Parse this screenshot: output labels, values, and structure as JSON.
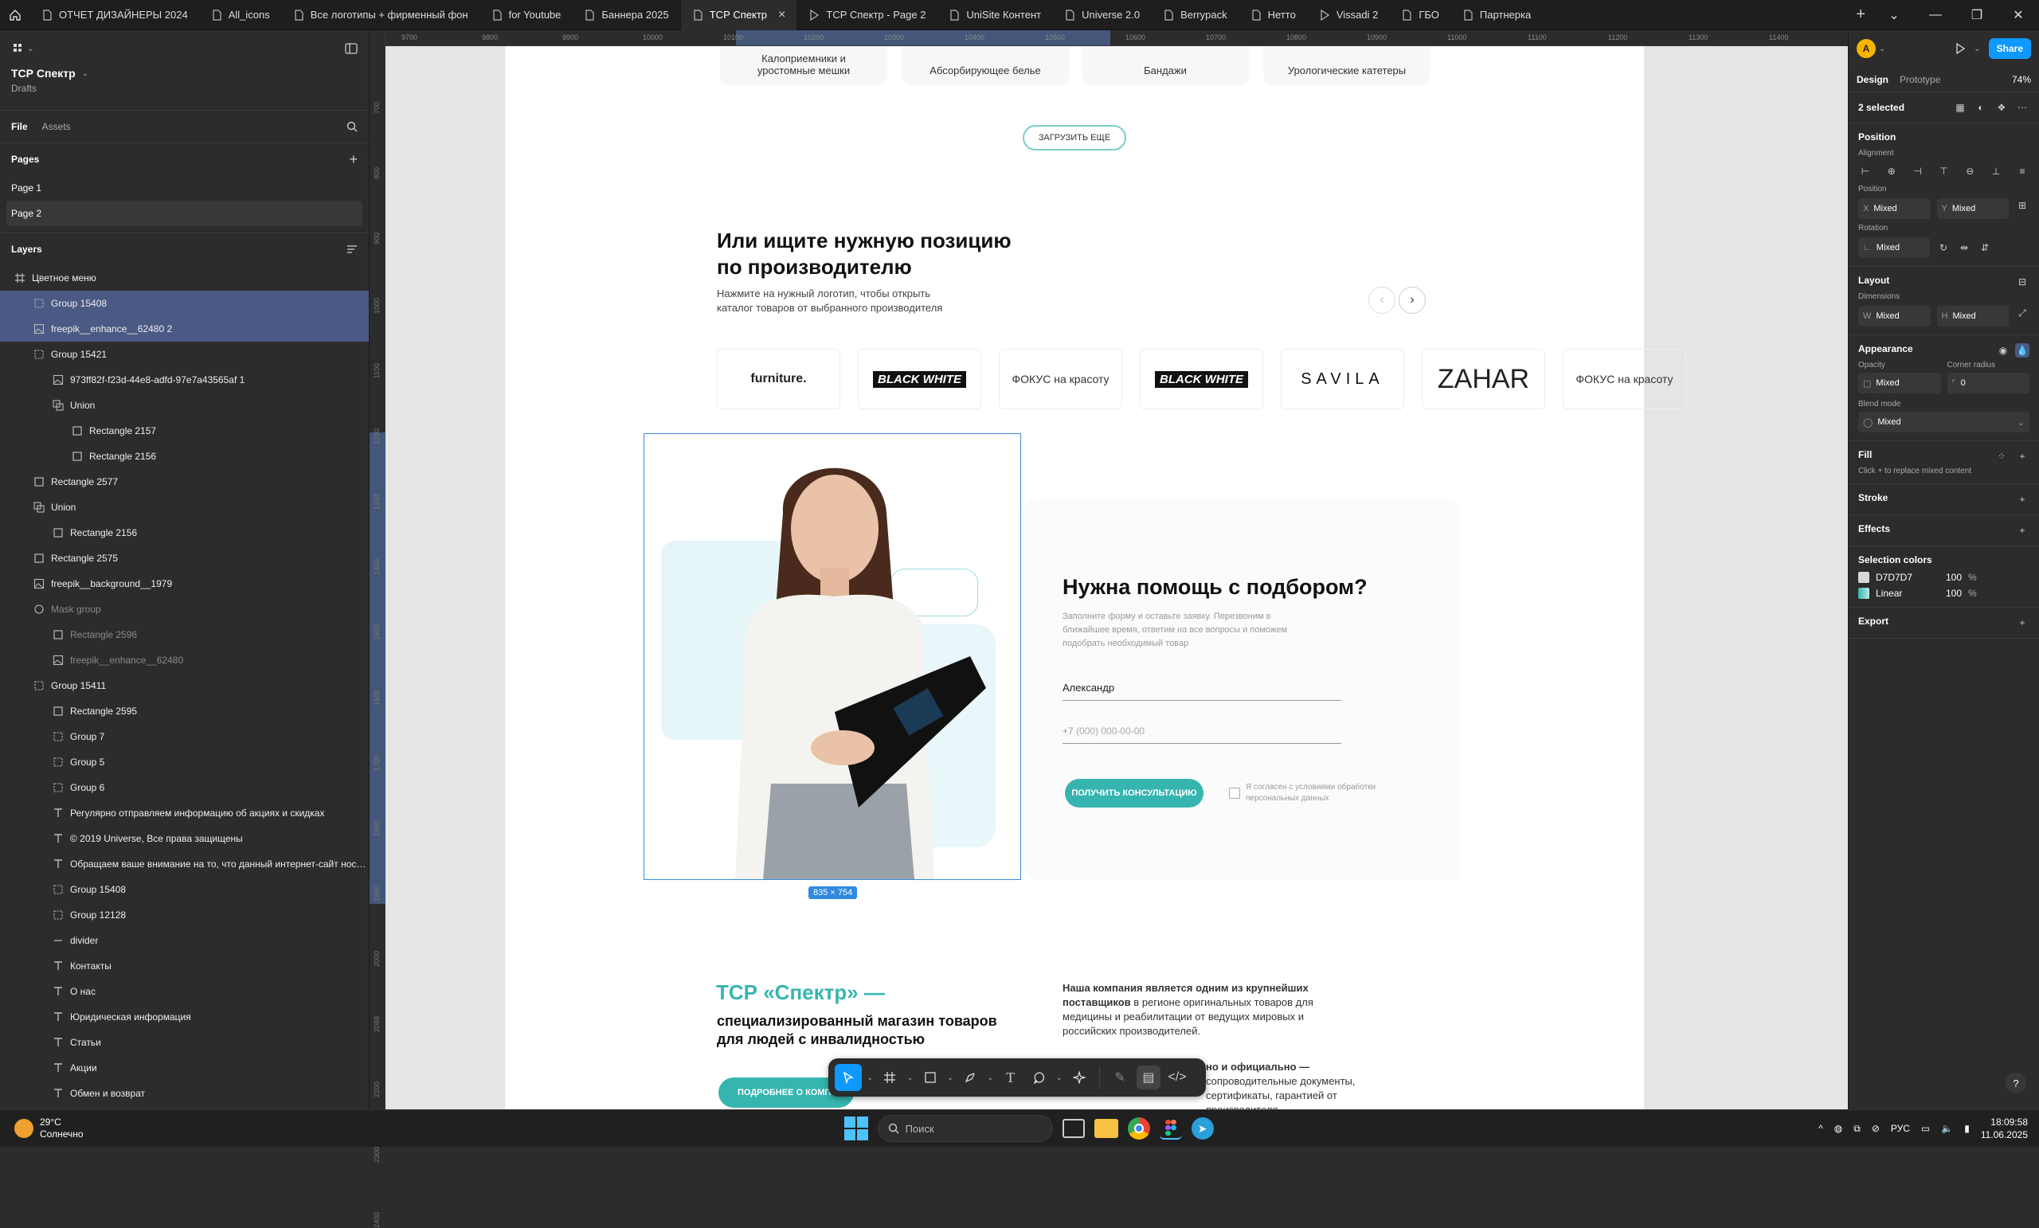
{
  "tabs": [
    {
      "label": "ОТЧЕТ ДИЗАЙНЕРЫ 2024",
      "icon": "file-icon",
      "active": false
    },
    {
      "label": "All_icons",
      "icon": "file-icon",
      "active": false
    },
    {
      "label": "Все логотипы + фирменный фон",
      "icon": "file-icon",
      "active": false
    },
    {
      "label": "for Youtube",
      "icon": "file-icon",
      "active": false
    },
    {
      "label": "Баннера 2025",
      "icon": "file-icon",
      "active": false
    },
    {
      "label": "ТСР Спектр",
      "icon": "file-icon",
      "active": true
    },
    {
      "label": "ТСР Спектр - Page 2",
      "icon": "play-icon",
      "active": false
    },
    {
      "label": "UniSite Контент",
      "icon": "file-icon",
      "active": false
    },
    {
      "label": "Universe 2.0",
      "icon": "file-icon",
      "active": false
    },
    {
      "label": "Berrypack",
      "icon": "file-icon",
      "active": false
    },
    {
      "label": "Нетто",
      "icon": "file-icon",
      "active": false
    },
    {
      "label": "Vissadi 2",
      "icon": "play-icon",
      "active": false
    },
    {
      "label": "ГБО",
      "icon": "file-icon",
      "active": false
    },
    {
      "label": "Партнерка",
      "icon": "file-icon",
      "active": false
    }
  ],
  "left": {
    "project_title": "ТСР Спектр",
    "project_sub": "Drafts",
    "file_tab": "File",
    "assets_tab": "Assets",
    "pages_label": "Pages",
    "pages": [
      "Page 1",
      "Page 2"
    ],
    "layers_label": "Layers",
    "layers": [
      {
        "label": "Цветное меню",
        "icon": "frame-icon",
        "indent": 0,
        "sel": false,
        "dim": false
      },
      {
        "label": "Group 15408",
        "icon": "group-icon",
        "indent": 1,
        "sel": true,
        "dim": false
      },
      {
        "label": "freepik__enhance__62480 2",
        "icon": "image-icon",
        "indent": 1,
        "sel": true,
        "dim": false
      },
      {
        "label": "Group 15421",
        "icon": "group-icon",
        "indent": 1,
        "sel": false,
        "dim": false
      },
      {
        "label": "973ff82f-f23d-44e8-adfd-97e7a43565af 1",
        "icon": "image-icon",
        "indent": 2,
        "sel": false,
        "dim": false
      },
      {
        "label": "Union",
        "icon": "union-icon",
        "indent": 2,
        "sel": false,
        "dim": false
      },
      {
        "label": "Rectangle 2157",
        "icon": "rect-icon",
        "indent": 3,
        "sel": false,
        "dim": false
      },
      {
        "label": "Rectangle 2156",
        "icon": "rect-icon",
        "indent": 3,
        "sel": false,
        "dim": false
      },
      {
        "label": "Rectangle 2577",
        "icon": "rect-icon",
        "indent": 1,
        "sel": false,
        "dim": false
      },
      {
        "label": "Union",
        "icon": "union-icon",
        "indent": 1,
        "sel": false,
        "dim": false
      },
      {
        "label": "Rectangle 2156",
        "icon": "rect-icon",
        "indent": 2,
        "sel": false,
        "dim": false
      },
      {
        "label": "Rectangle 2575",
        "icon": "rect-icon",
        "indent": 1,
        "sel": false,
        "dim": false
      },
      {
        "label": "freepik__background__1979",
        "icon": "image-icon",
        "indent": 1,
        "sel": false,
        "dim": false
      },
      {
        "label": "Mask group",
        "icon": "mask-icon",
        "indent": 1,
        "sel": false,
        "dim": true
      },
      {
        "label": "Rectangle 2596",
        "icon": "rect-icon",
        "indent": 2,
        "sel": false,
        "dim": true
      },
      {
        "label": "freepik__enhance__62480",
        "icon": "image-icon",
        "indent": 2,
        "sel": false,
        "dim": true
      },
      {
        "label": "Group 15411",
        "icon": "group-icon",
        "indent": 1,
        "sel": false,
        "dim": false
      },
      {
        "label": "Rectangle 2595",
        "icon": "rect-icon",
        "indent": 2,
        "sel": false,
        "dim": false
      },
      {
        "label": "Group 7",
        "icon": "group-icon",
        "indent": 2,
        "sel": false,
        "dim": false
      },
      {
        "label": "Group 5",
        "icon": "group-icon",
        "indent": 2,
        "sel": false,
        "dim": false
      },
      {
        "label": "Group 6",
        "icon": "group-icon",
        "indent": 2,
        "sel": false,
        "dim": false
      },
      {
        "label": "Регулярно отправляем информацию об акциях и скидках",
        "icon": "text-icon",
        "indent": 2,
        "sel": false,
        "dim": false
      },
      {
        "label": "© 2019 Universe, Все права защищены",
        "icon": "text-icon",
        "indent": 2,
        "sel": false,
        "dim": false
      },
      {
        "label": "Обращаем ваше внимание на то, что данный интернет-сайт носит и",
        "icon": "text-icon",
        "indent": 2,
        "sel": false,
        "dim": false
      },
      {
        "label": "Group 15408",
        "icon": "group-icon",
        "indent": 2,
        "sel": false,
        "dim": false
      },
      {
        "label": "Group 12128",
        "icon": "group-icon",
        "indent": 2,
        "sel": false,
        "dim": false
      },
      {
        "label": "divider",
        "icon": "line-icon",
        "indent": 2,
        "sel": false,
        "dim": false
      },
      {
        "label": "Контакты",
        "icon": "text-icon",
        "indent": 2,
        "sel": false,
        "dim": false
      },
      {
        "label": "О нас",
        "icon": "text-icon",
        "indent": 2,
        "sel": false,
        "dim": false
      },
      {
        "label": "Юридическая информация",
        "icon": "text-icon",
        "indent": 2,
        "sel": false,
        "dim": false
      },
      {
        "label": "Статьи",
        "icon": "text-icon",
        "indent": 2,
        "sel": false,
        "dim": false
      },
      {
        "label": "Акции",
        "icon": "text-icon",
        "indent": 2,
        "sel": false,
        "dim": false
      },
      {
        "label": "Обмен и возврат",
        "icon": "text-icon",
        "indent": 2,
        "sel": false,
        "dim": false
      }
    ]
  },
  "ruler": {
    "h_ticks": [
      "9700",
      "9800",
      "9900",
      "10000",
      "10100",
      "10200",
      "10300",
      "10400",
      "10500",
      "10600",
      "10700",
      "10800",
      "10900",
      "11000",
      "11100",
      "11200",
      "11300",
      "11400",
      "11500"
    ],
    "v_ticks": [
      "700",
      "800",
      "900",
      "1000",
      "1100",
      "1200",
      "1334",
      "1400",
      "1500",
      "1600",
      "1700",
      "1800",
      "1900",
      "2000",
      "2088",
      "2200",
      "2300",
      "2400"
    ],
    "v_marks": [
      "1334",
      "2088"
    ]
  },
  "page": {
    "top_cards": [
      "Калоприемники и уростомные мешки",
      "Абсорбирующее белье",
      "Бандажи",
      "Урологические катетеры"
    ],
    "load_more": "ЗАГРУЗИТЬ ЕЩЕ",
    "mfr_title": "Или ищите нужную позицию по производителю",
    "mfr_sub": "Нажмите на нужный логотип, чтобы открыть каталог товаров от выбранного производителя",
    "logos": [
      "furniture.",
      "BLACK WHITE",
      "ФОКУС на красоту",
      "BLACK WHITE",
      "SAVILA",
      "ZAHAR",
      "ФОКУС на красоту"
    ],
    "selection_size": "835 × 754",
    "help_title": "Нужна помощь с подбором?",
    "help_sub": "Заполните форму и оставьте заявку. Перезвоним в ближайшее время, ответим на все вопросы и поможем подобрать необходимый товар",
    "name_value": "Александр",
    "phone_prefix": "+7",
    "phone_placeholder": "(000) 000-00-00",
    "consult_button": "ПОЛУЧИТЬ КОНСУЛЬТАЦИЮ",
    "agree_text": "Я согласен с условиями обработки персональных данных",
    "about_brand": "ТСР «Спектр» —",
    "about_title": "специализированный магазин товаров для людей с инвалидностью",
    "about_text_bold": "Наша компания является одним из крупнейших поставщиков",
    "about_text": "в регионе оригинальных товаров для медицины и реабилитации от ведущих мировых и российских производителей.",
    "about_text2_bold": "но и официально —",
    "about_text2": "сопроводительные документы, сертификаты, гарантией от производителя.",
    "more_button": "ПОДРОБНЕЕ О КОМП"
  },
  "right": {
    "avatar": "A",
    "share": "Share",
    "design_tab": "Design",
    "prototype_tab": "Prototype",
    "zoom": "74%",
    "selected": "2 selected",
    "position_h": "Position",
    "alignment": "Alignment",
    "position_label": "Position",
    "x_key": "X",
    "x_val": "Mixed",
    "y_key": "Y",
    "y_val": "Mixed",
    "rotation": "Rotation",
    "rot_val": "Mixed",
    "layout_h": "Layout",
    "dimensions": "Dimensions",
    "w_key": "W",
    "w_val": "Mixed",
    "h_key": "H",
    "h_val": "Mixed",
    "appearance_h": "Appearance",
    "opacity": "Opacity",
    "corner_radius": "Corner radius",
    "opacity_val": "Mixed",
    "radius_val": "0",
    "blend_mode": "Blend mode",
    "blend_val": "Mixed",
    "fill_h": "Fill",
    "fill_hint": "Click + to replace mixed content",
    "stroke_h": "Stroke",
    "effects_h": "Effects",
    "selcolors_h": "Selection colors",
    "color1": "D7D7D7",
    "color1_pct": "100",
    "color2": "Linear",
    "color2_pct": "100",
    "pct": "%",
    "export_h": "Export",
    "help_btn": "?"
  },
  "taskbar": {
    "weather_temp": "29°C",
    "weather_text": "Солнечно",
    "search_placeholder": "Поиск",
    "lang": "РУС",
    "time": "18:09:58",
    "date": "11.06.2025"
  },
  "colors": {
    "accent": "#36b5b0",
    "selection": "#4a5a84",
    "share": "#0d99ff"
  }
}
